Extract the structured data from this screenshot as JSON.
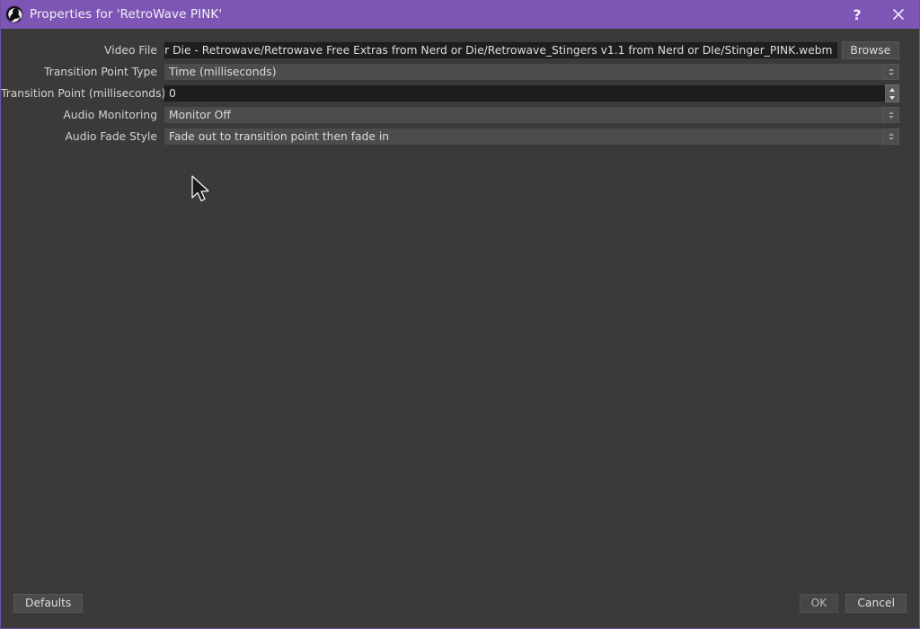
{
  "window": {
    "title": "Properties for 'RetroWave PINK'",
    "icon": "obs-logo-icon",
    "help_label": "?",
    "close_label": "✕",
    "accent_color": "#7d55b5",
    "background_color": "#3b3a38"
  },
  "form": {
    "rows": [
      {
        "label": "Video File",
        "value": "HICS/Twitch/Nerd or Die - Retrowave/Retrowave Free Extras from Nerd or Die/Retrowave_Stingers v1.1 from Nerd or DIe/Stinger_PINK.webm",
        "type": "line-edit"
      },
      {
        "label": "Transition Point Type",
        "value": "Time (milliseconds)",
        "type": "combo"
      },
      {
        "label": "Transition Point (milliseconds)",
        "value": "0",
        "type": "spinbox"
      },
      {
        "label": "Audio Monitoring",
        "value": "Monitor Off",
        "type": "combo"
      },
      {
        "label": "Audio Fade Style",
        "value": "Fade out to transition point then fade in",
        "type": "combo"
      }
    ],
    "browse_label": "Browse"
  },
  "footer": {
    "defaults_label": "Defaults",
    "ok_label": "OK",
    "cancel_label": "Cancel"
  }
}
